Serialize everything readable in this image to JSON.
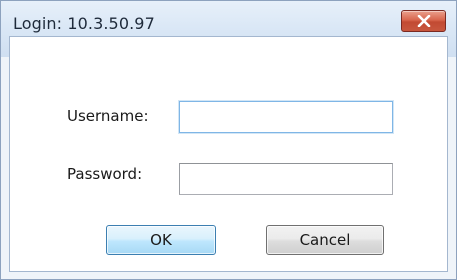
{
  "window": {
    "title": "Login: 10.3.50.97"
  },
  "icons": {
    "close": "close-icon"
  },
  "form": {
    "username": {
      "label": "Username:",
      "value": "",
      "placeholder": ""
    },
    "password": {
      "label": "Password:",
      "value": "",
      "placeholder": ""
    }
  },
  "buttons": {
    "ok_label": "OK",
    "cancel_label": "Cancel"
  },
  "colors": {
    "close_button": "#c8573e",
    "ok_border": "#3c7fb1"
  }
}
